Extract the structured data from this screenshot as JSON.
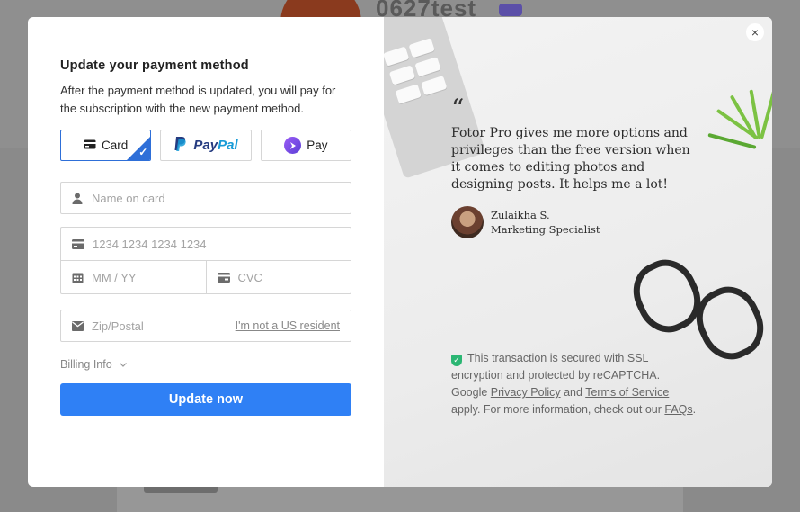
{
  "background": {
    "username": "0627test"
  },
  "modal": {
    "title": "Update your payment method",
    "description": "After the payment method is updated, you will pay for the subscription with the new payment method.",
    "methods": {
      "card": "Card",
      "paypal_part1": "Pay",
      "paypal_part2": "Pal",
      "pay": "Pay"
    },
    "fields": {
      "name_placeholder": "Name on card",
      "card_number_placeholder": "1234 1234 1234 1234",
      "expiry_placeholder": "MM / YY",
      "cvc_placeholder": "CVC",
      "zip_placeholder": "Zip/Postal",
      "not_us_link": "I'm not a US resident"
    },
    "billing_info": "Billing Info",
    "update_button": "Update now",
    "accent_color": "#2f80f5"
  },
  "testimonial": {
    "quote_mark": "“",
    "quote": "Fotor Pro gives me more options and privileges than the free version when it comes to editing photos and designing posts. It helps me a lot!",
    "author_name": "Zulaikha S.",
    "author_role": "Marketing Specialist"
  },
  "security": {
    "text1": "This transaction is secured with SSL encryption and protected by reCAPTCHA. Google",
    "privacy_link": "Privacy Policy",
    "and": "and",
    "terms_link": "Terms of Service",
    "text2": "apply. For more information, check out our",
    "faq_link": "FAQs",
    "period": "."
  },
  "close_symbol": "×"
}
